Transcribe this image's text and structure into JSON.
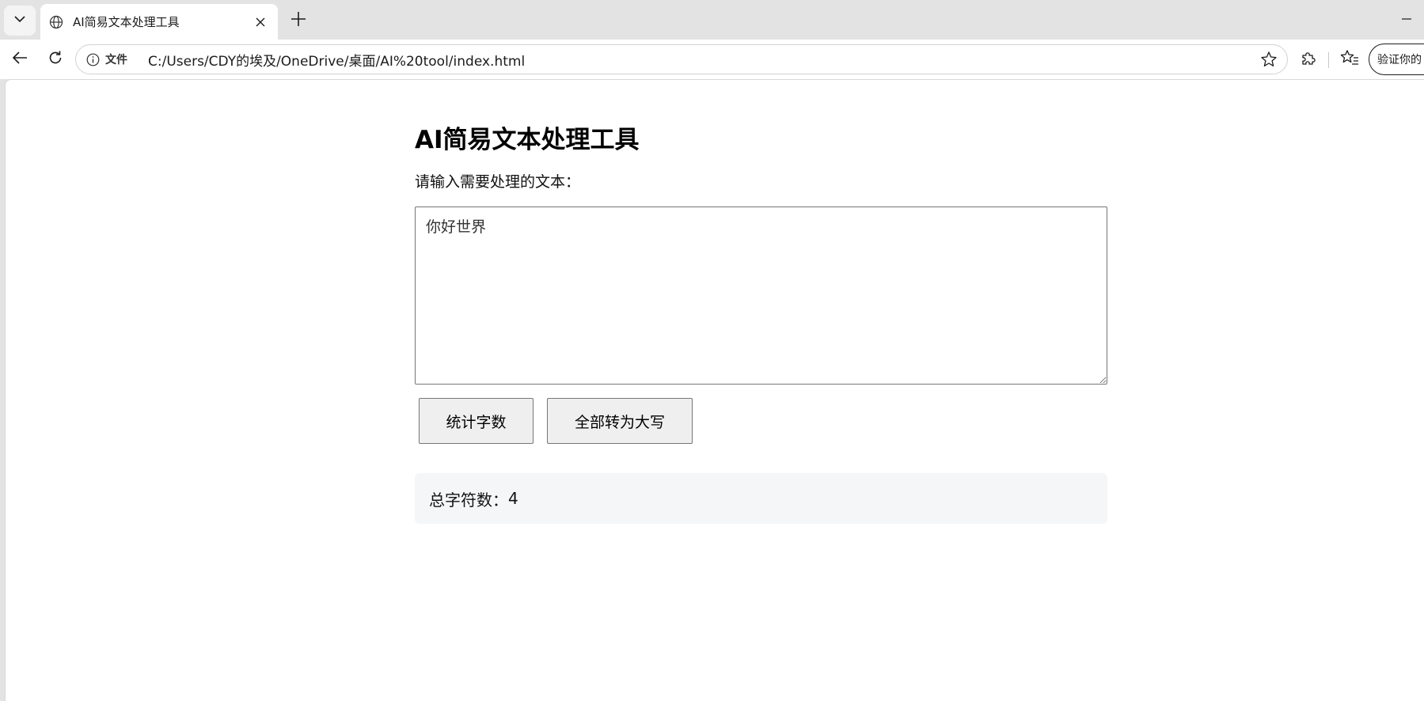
{
  "browser": {
    "tab_title": "AI简易文本处理工具",
    "scheme_label": "文件",
    "url": "C:/Users/CDY的埃及/OneDrive/桌面/AI%20tool/index.html",
    "profile_label": "验证你的"
  },
  "page": {
    "title": "AI简易文本处理工具",
    "prompt_label": "请输入需要处理的文本：",
    "textarea_value": "你好世界",
    "buttons": {
      "count_label": "统计字数",
      "uppercase_label": "全部转为大写"
    },
    "result": {
      "label": "总字符数：",
      "value": "4"
    }
  },
  "icons": {
    "tab_menu": "chevron-down-icon",
    "favicon": "globe-icon",
    "tab_close": "close-icon",
    "new_tab": "plus-icon",
    "minimize": "minimize-icon",
    "back": "arrow-left-icon",
    "reload": "reload-icon",
    "info": "info-icon",
    "favorite": "star-icon",
    "extensions": "puzzle-icon",
    "favorites": "favorites-icon"
  }
}
